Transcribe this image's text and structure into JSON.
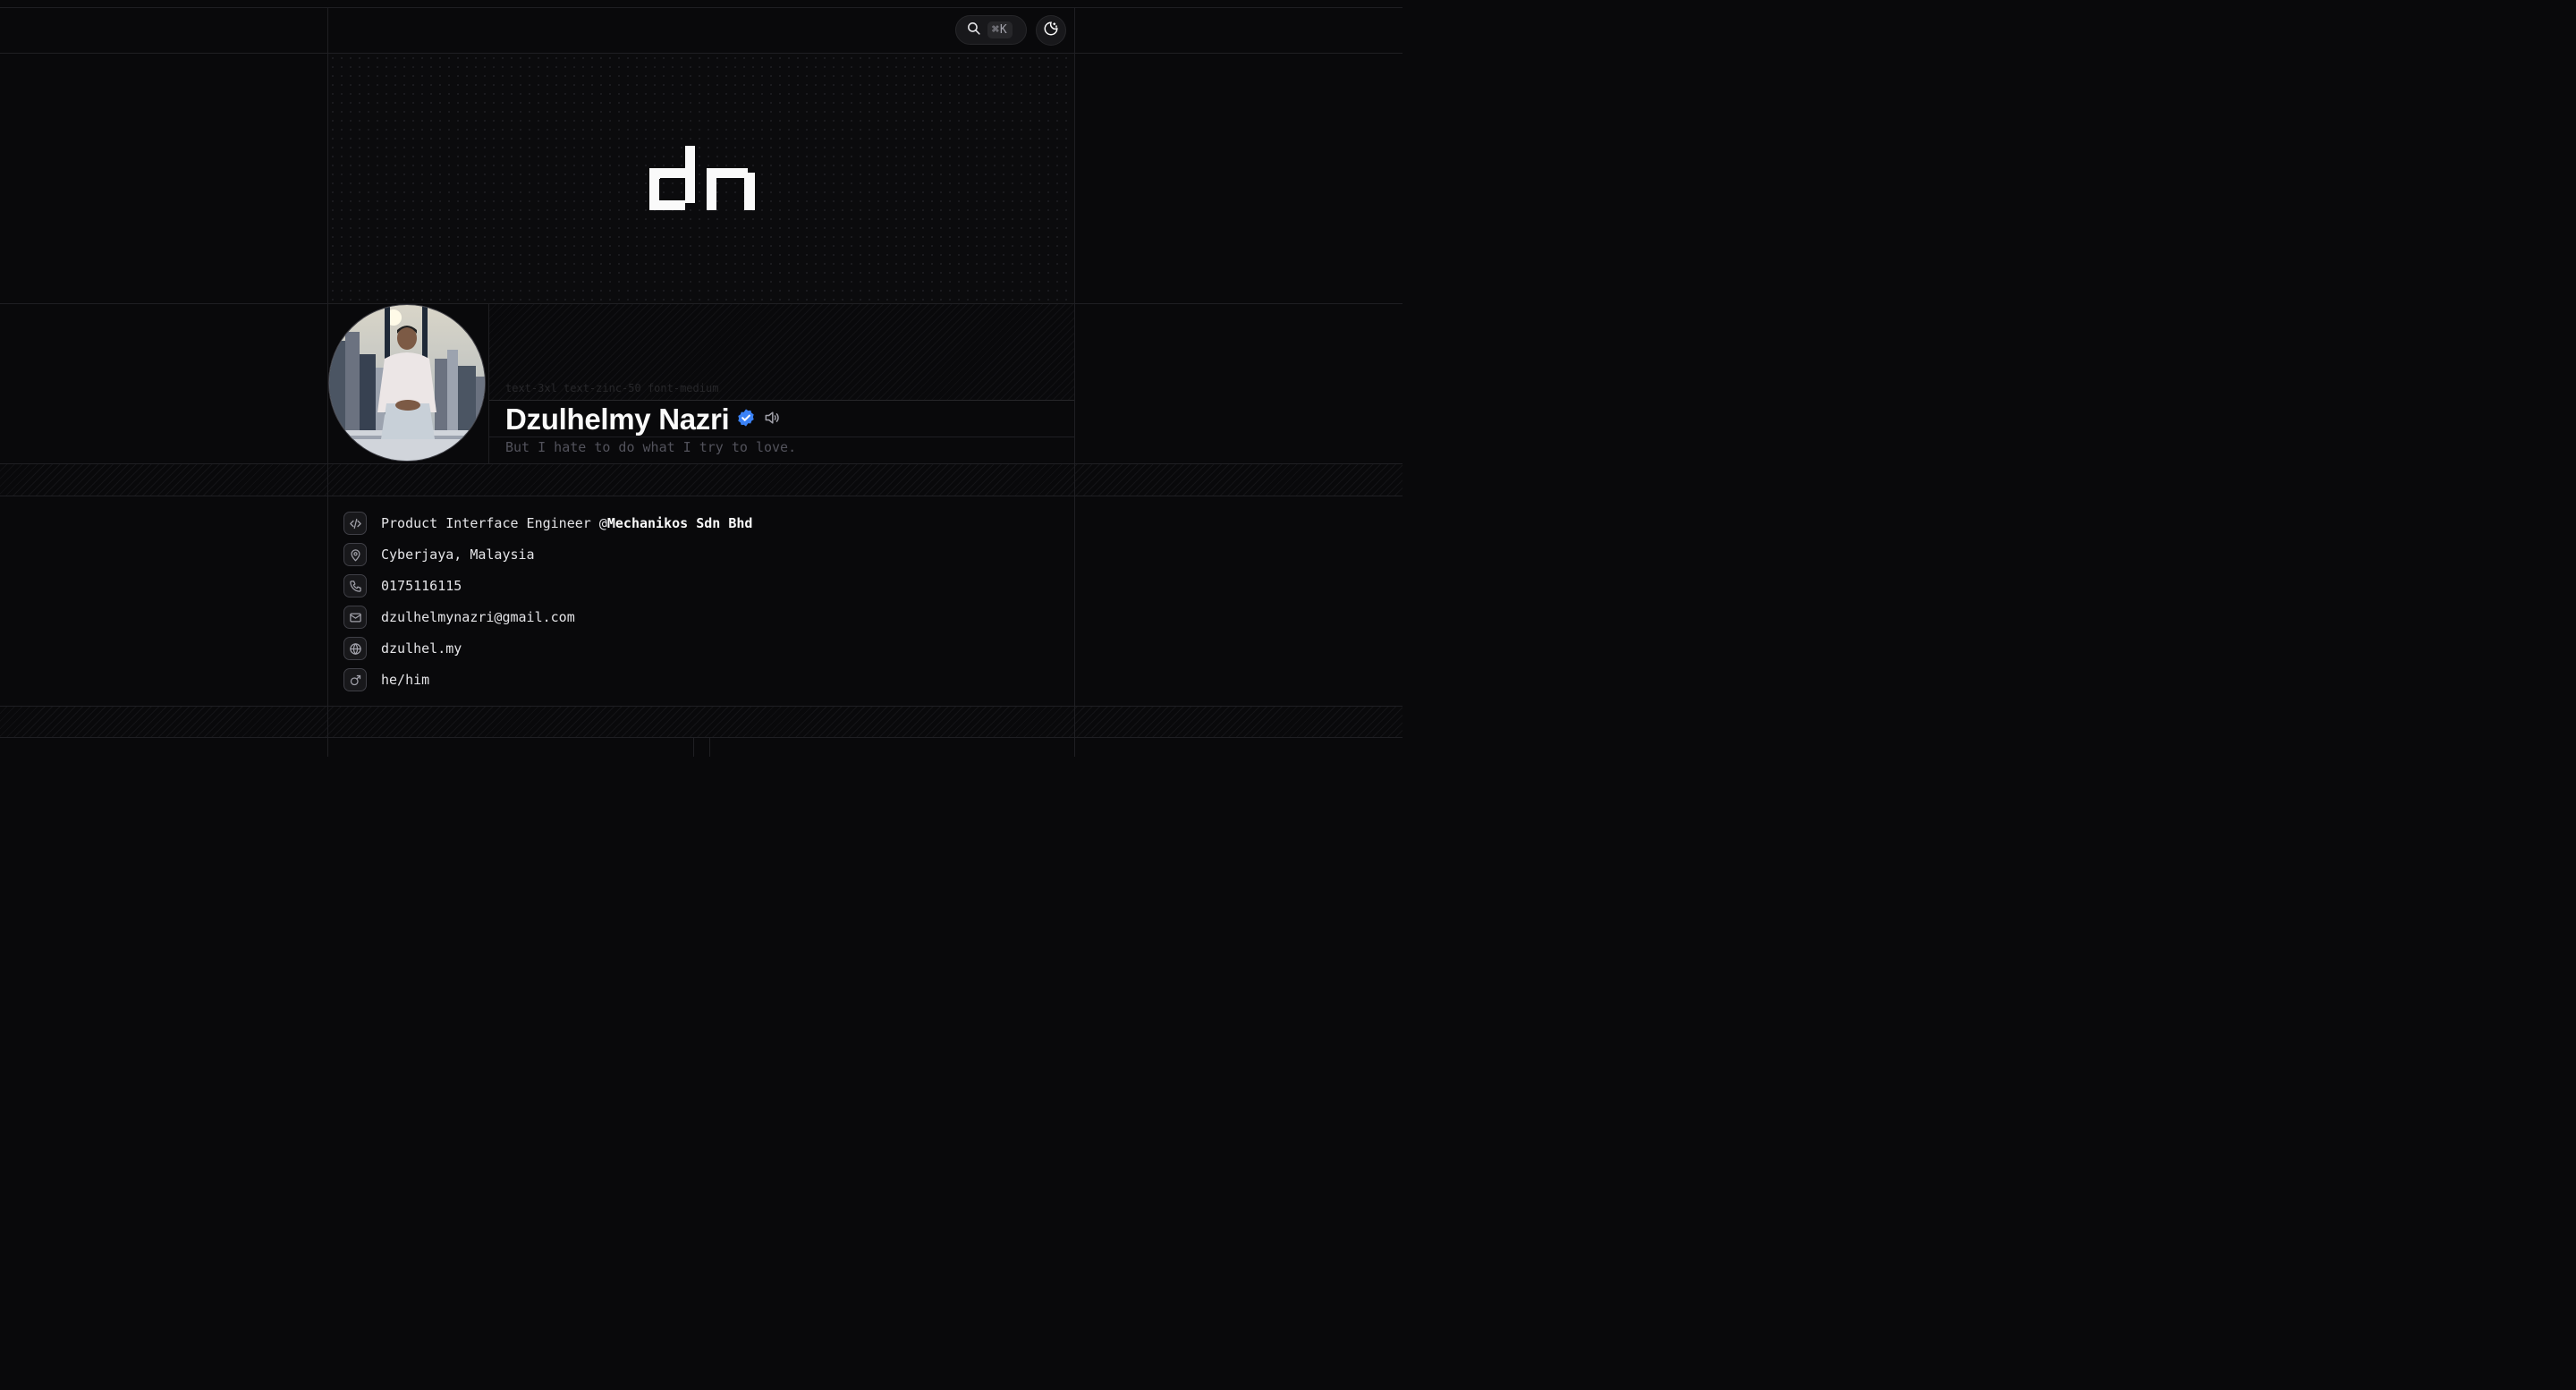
{
  "header": {
    "search_shortcut": "⌘K",
    "icons": {
      "search": "search-icon",
      "theme": "moon-sun-icon"
    }
  },
  "cover": {
    "logo_text": "dn"
  },
  "profile": {
    "class_hint": "text-3xl text-zinc-50 font-medium",
    "name": "Dzulhelmy Nazri",
    "tagline": "But I hate to do what I try to love.",
    "verified_color": "#3b82f6"
  },
  "info": {
    "items": [
      {
        "icon": "code-icon",
        "text": "Product Interface Engineer @",
        "strong": "Mechanikos Sdn Bhd"
      },
      {
        "icon": "map-pin-icon",
        "text": "Cyberjaya, Malaysia"
      },
      {
        "icon": "phone-icon",
        "text": "0175116115"
      },
      {
        "icon": "mail-icon",
        "text": "dzulhelmynazri@gmail.com"
      },
      {
        "icon": "globe-icon",
        "text": "dzulhel.my"
      },
      {
        "icon": "mars-icon",
        "text": "he/him"
      }
    ]
  },
  "colors": {
    "background": "#09090b",
    "border": "#1f1f23",
    "text": "#fafafa",
    "muted": "#52525b"
  }
}
